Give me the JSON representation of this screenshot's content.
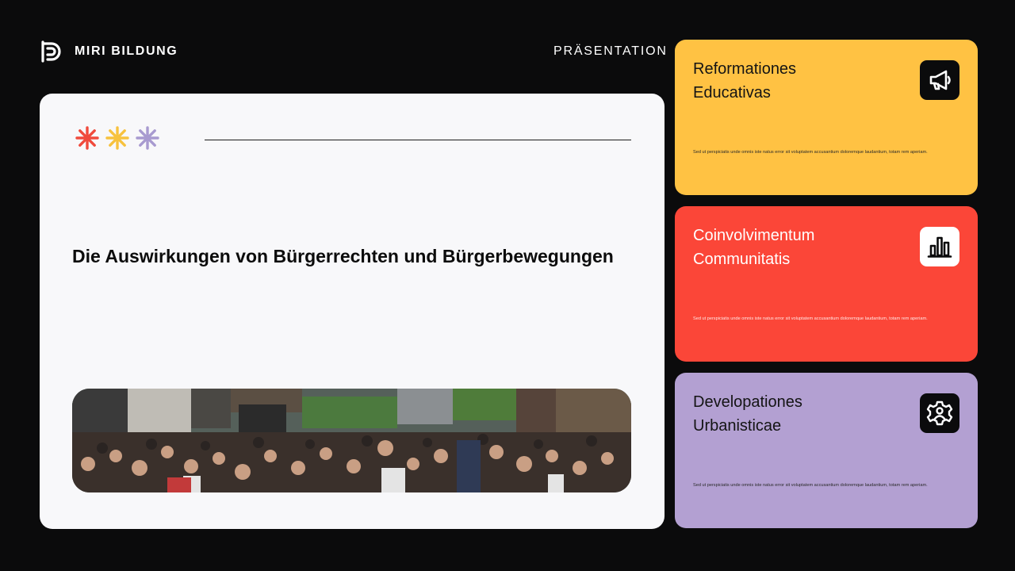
{
  "brand": {
    "name": "MIRI BILDUNG",
    "logo_icon": "brand-logo-icon"
  },
  "header": {
    "label": "PRÄSENTATION"
  },
  "main": {
    "decoration_icons": [
      "asterisk-red-icon",
      "asterisk-yellow-icon",
      "asterisk-purple-icon"
    ],
    "decoration_colors": [
      "#f04a3c",
      "#f7c23e",
      "#a89ad0"
    ],
    "title": "Die Auswirkungen von Bürgerrechten und Bürgerbewegungen",
    "image": "crowd-protest-photo"
  },
  "cards": [
    {
      "title": "Reformationes\nEducativas",
      "text": "Sed ut perspiciatis unde omnis iste natus error sit voluptatem accusantium doloremque laudantium, totam rem aperiam.",
      "icon": "megaphone-icon",
      "color": "#ffc243"
    },
    {
      "title": "Coinvolvimentum\nCommunitatis",
      "text": "Sed ut perspiciatis unde omnis iste natus error sit voluptatem accusantium doloremque laudantium, totam rem aperiam.",
      "icon": "bar-chart-icon",
      "color": "#fb4638"
    },
    {
      "title": "Developationes\nUrbanisticae",
      "text": "Sed ut perspiciatis unde omnis iste natus error sit voluptatem accusantium doloremque laudantium, totam rem aperiam.",
      "icon": "gear-people-icon",
      "color": "#b3a0d2"
    }
  ]
}
